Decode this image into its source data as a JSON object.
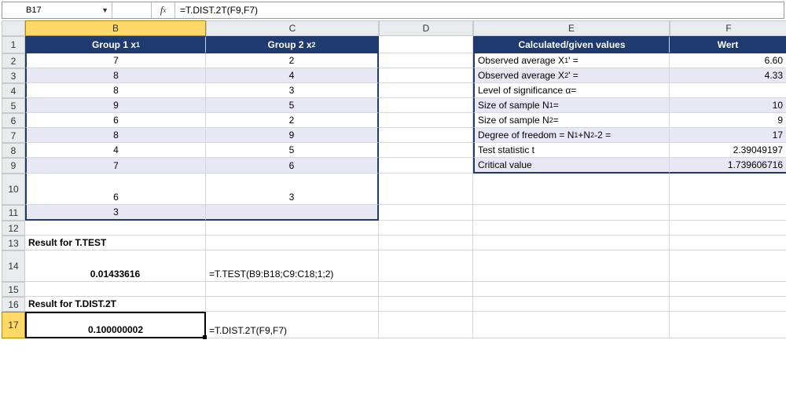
{
  "nameBox": "B17",
  "formula": "=T.DIST.2T(F9,F7)",
  "columns": [
    "B",
    "C",
    "D",
    "E",
    "F"
  ],
  "rows": [
    "1",
    "2",
    "3",
    "4",
    "5",
    "6",
    "7",
    "8",
    "9",
    "10",
    "11",
    "12",
    "13",
    "14",
    "15",
    "16",
    "17"
  ],
  "hdr": {
    "b": "Group 1 x",
    "bSub": "1",
    "c": "Group 2 x",
    "cSub": "2",
    "e": "Calculated/given values",
    "f": "Wert"
  },
  "g1": [
    "7",
    "8",
    "8",
    "9",
    "6",
    "8",
    "4",
    "7",
    "6",
    "3"
  ],
  "g2": [
    "2",
    "4",
    "3",
    "5",
    "2",
    "9",
    "5",
    "6",
    "3",
    ""
  ],
  "calc": {
    "r2l": "Observed average X",
    "r2s": "1",
    "r2p": "' =",
    "r2v": "6.60",
    "r3l": "Observed average X",
    "r3s": "2",
    "r3p": "' =",
    "r3v": "4.33",
    "r4l": "Level of significance α=",
    "r4v": "",
    "r5l": "Size of sample N",
    "r5s": "1",
    "r5p": "=",
    "r5v": "10",
    "r6l": "Size of sample N",
    "r6s": "2",
    "r6p": "=",
    "r6v": "9",
    "r7l": "Degree of freedom = N",
    "r7s1": "1",
    "r7m": "+N",
    "r7s2": "2",
    "r7p": "-2 =",
    "r7v": "17",
    "r8l": "Test statistic t",
    "r8v": "2.39049197",
    "r9l": "Critical value",
    "r9v": "1.739606716"
  },
  "r13": "Result for T.TEST",
  "r14b": "0.01433616",
  "r14c": "=T.TEST(B9:B18;C9:C18;1;2)",
  "r16": "Result for T.DIST.2T",
  "r17b": "0.100000002",
  "r17c": "=T.DIST.2T(F9,F7)",
  "chart_data": {
    "type": "table",
    "group1": [
      7,
      8,
      8,
      9,
      6,
      8,
      4,
      7,
      6,
      3
    ],
    "group2": [
      2,
      4,
      3,
      5,
      2,
      9,
      5,
      6,
      3
    ],
    "observed_avg_x1": 6.6,
    "observed_avg_x2": 4.33,
    "n1": 10,
    "n2": 9,
    "degrees_of_freedom": 17,
    "t_statistic": 2.39049197,
    "critical_value": 1.739606716,
    "t_test_result": 0.01433616,
    "t_dist_2t_result": 0.100000002
  }
}
